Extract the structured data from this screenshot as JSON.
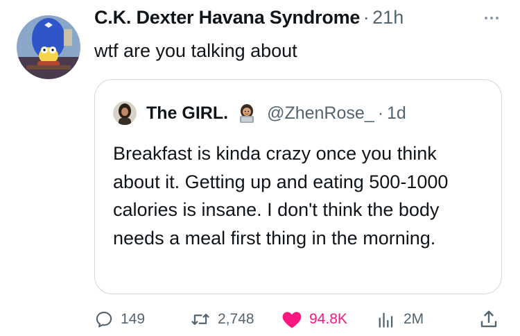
{
  "tweet": {
    "display_name": "C.K. Dexter Havana Syndrome",
    "separator": "·",
    "time": "21h",
    "text": "wtf are you talking about",
    "avatar_icon": "cartoon-avatar-icon",
    "more_icon": "more-options-icon"
  },
  "quote": {
    "display_name": "The GIRL.",
    "name_emoji": "woman-technologist-emoji",
    "handle": "@ZhenRose_",
    "separator": "·",
    "time": "1d",
    "text": "Breakfast is kinda crazy once you think about it. Getting up and eating 500-1000 calories is insane. I don't think the body needs a meal first thing in the morning."
  },
  "actions": {
    "replies": "149",
    "reposts": "2,748",
    "likes": "94.8K",
    "views": "2M",
    "like_color": "#f91880",
    "icon_color": "#536471"
  }
}
